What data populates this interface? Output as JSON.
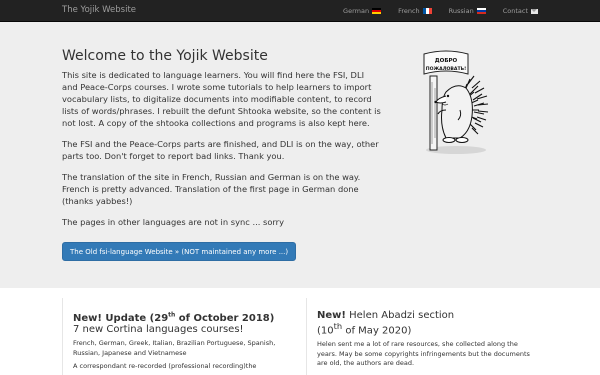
{
  "navbar": {
    "brand": "The Yojik Website",
    "links": [
      {
        "label": "German",
        "icon": "flag-germany-icon"
      },
      {
        "label": "French",
        "icon": "flag-france-icon"
      },
      {
        "label": "Russian",
        "icon": "flag-russia-icon"
      },
      {
        "label": "Contact",
        "icon": "envelope-icon"
      }
    ]
  },
  "hero": {
    "title": "Welcome to the Yojik Website",
    "paragraphs": [
      "This site is dedicated to language learners. You will find here the FSI, DLI and Peace-Corps courses. I wrote some tutorials to help learners to import vocabulary lists, to digitalize documents into modifiable content, to record lists of words/phrases. I rebuilt the defunt Shtooka website, so the content is not lost. A copy of the shtooka collections and programs is also kept here.",
      "The FSI and the Peace-Corps parts are finished, and DLI is on the way, other parts too. Don't forget to report bad links. Thank you.",
      "The translation of the site in French, Russian and German is on the way. French is pretty advanced. Translation of the first page in German done (thanks yabbes!)",
      "The pages in other languages are not in sync ... sorry"
    ],
    "button_label": "The Old fsi-language Website » (NOT maintained any more ...)",
    "image_sign_text": "ДОБРО ПОЖАЛОВАТЬ!"
  },
  "cards": {
    "left": {
      "title_bold_prefix": "New! Update (29",
      "title_sup": "th",
      "title_bold_suffix": " of October 2018)",
      "subtitle": "7 new Cortina languages courses!",
      "body": "French, German, Greek, Italian, Brazilian Portuguese, Spanish, Russian, Japanese and Vietnamese",
      "body2": "A correspondant re-recorded (professional recording)the"
    },
    "right": {
      "title_bold": "New!",
      "title_rest": " Helen Abadzi section",
      "date_prefix": "(10",
      "date_sup": "th",
      "date_suffix": " of May 2020)",
      "body": "Helen sent me a lot of rare resources, she collected along the years. May be some copyrights infringements but the documents are old, the authors are dead."
    }
  }
}
